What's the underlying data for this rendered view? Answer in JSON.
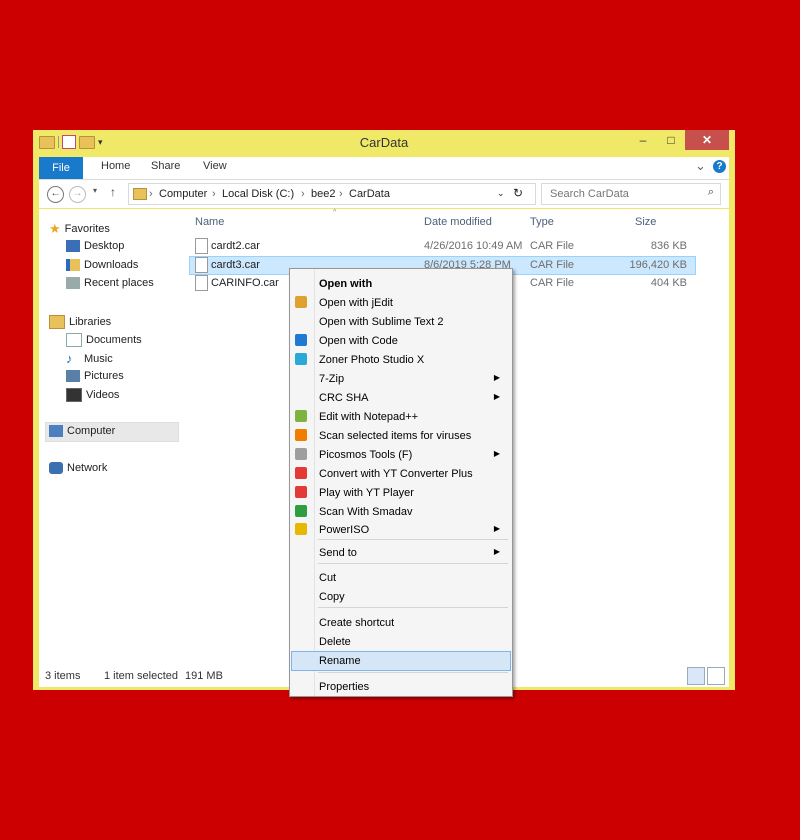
{
  "window": {
    "title": "CarData",
    "buttons": {
      "minimize": "–",
      "maximize": "□",
      "close": "✕"
    }
  },
  "ribbon": {
    "tabs": [
      "File",
      "Home",
      "Share",
      "View"
    ],
    "chevron": "⌄",
    "help": "?"
  },
  "address": {
    "back": "←",
    "forward": "→",
    "up": "↑",
    "crumbs": [
      "Computer",
      "Local Disk (C:)",
      "bee2",
      "CarData"
    ],
    "separator": "›",
    "refresh": "↻",
    "search_placeholder": "Search CarData"
  },
  "navpane": {
    "favorites": "Favorites",
    "favorite_items": [
      "Desktop",
      "Downloads",
      "Recent places"
    ],
    "libraries": "Libraries",
    "library_items": [
      "Documents",
      "Music",
      "Pictures",
      "Videos"
    ],
    "computer": "Computer",
    "network": "Network"
  },
  "columns": {
    "name": "Name",
    "date": "Date modified",
    "type": "Type",
    "size": "Size"
  },
  "files": [
    {
      "name": "cardt2.car",
      "date": "4/26/2016 10:49 AM",
      "type": "CAR File",
      "size": "836 KB"
    },
    {
      "name": "cardt3.car",
      "date": "8/6/2019 5:28 PM",
      "type": "CAR File",
      "size": "196,420 KB"
    },
    {
      "name": "CARINFO.car",
      "date": "",
      "type": "CAR File",
      "size": "404 KB"
    }
  ],
  "status": {
    "count": "3 items",
    "selection": "1 item selected",
    "size": "191 MB"
  },
  "context_menu": {
    "items": [
      {
        "label": "Open with",
        "bold": true
      },
      {
        "label": "Open with jEdit",
        "icon": "jedit-icon",
        "color": "#e0a030"
      },
      {
        "label": "Open with Sublime Text 2"
      },
      {
        "label": "Open with Code",
        "icon": "vscode-icon",
        "color": "#1f78d1"
      },
      {
        "label": "Zoner Photo Studio X",
        "icon": "zoner-icon",
        "color": "#2aa8d8"
      },
      {
        "label": "7-Zip",
        "submenu": true
      },
      {
        "label": "CRC SHA",
        "submenu": true
      },
      {
        "label": "Edit with Notepad++",
        "icon": "notepadpp-icon",
        "color": "#7cb342"
      },
      {
        "label": "Scan selected items for viruses",
        "icon": "avast-icon",
        "color": "#f07c00"
      },
      {
        "label": "Picosmos Tools (F)",
        "icon": "picosmos-icon",
        "color": "#9e9e9e",
        "submenu": true
      },
      {
        "label": "Convert with YT Converter Plus",
        "icon": "yt-converter-icon",
        "color": "#e53935"
      },
      {
        "label": "Play with YT Player",
        "icon": "yt-player-icon",
        "color": "#e53935"
      },
      {
        "label": "Scan With Smadav",
        "icon": "smadav-icon",
        "color": "#2e9e3e"
      },
      {
        "label": "PowerISO",
        "icon": "poweriso-icon",
        "color": "#e6b800",
        "submenu": true
      },
      {
        "label": "Send to",
        "submenu": true
      },
      {
        "label": "Cut"
      },
      {
        "label": "Copy"
      },
      {
        "label": "Create shortcut"
      },
      {
        "label": "Delete"
      },
      {
        "label": "Rename",
        "highlighted": true
      },
      {
        "label": "Properties"
      }
    ]
  },
  "colors": {
    "background": "#cc0000",
    "frame": "#f0e968",
    "accent": "#1979ca",
    "selection": "#cce8ff"
  }
}
